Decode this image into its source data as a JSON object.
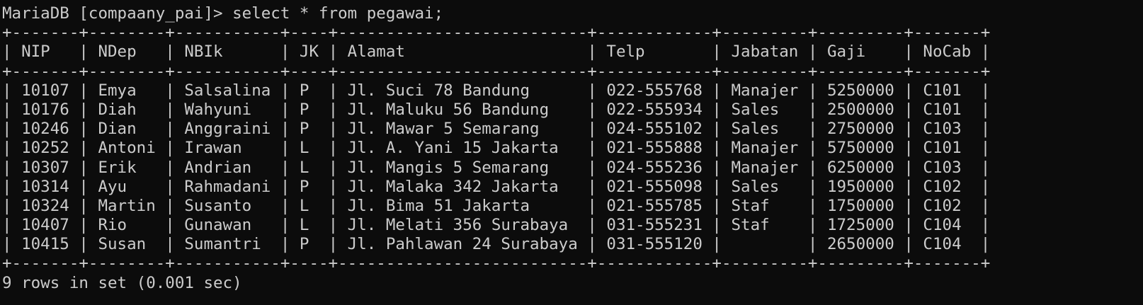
{
  "terminal": {
    "background": "#0c0c0c",
    "foreground": "#cccccc",
    "lines": [
      "MariaDB [compaany_pai]> select * from pegawai;",
      "+-------+--------+-----------+----+--------------------------+------------+---------+---------+-------+",
      "| NIP   | NDep   | NBIk      | JK | Alamat                   | Telp       | Jabatan | Gaji    | NoCab |",
      "+-------+--------+-----------+----+--------------------------+------------+---------+---------+-------+",
      "| 10107 | Emya   | Salsalina | P  | Jl. Suci 78 Bandung      | 022-555768 | Manajer | 5250000 | C101  |",
      "| 10176 | Diah   | Wahyuni   | P  | Jl. Maluku 56 Bandung    | 022-555934 | Sales   | 2500000 | C101  |",
      "| 10246 | Dian   | Anggraini | P  | Jl. Mawar 5 Semarang     | 024-555102 | Sales   | 2750000 | C103  |",
      "| 10252 | Antoni | Irawan    | L  | Jl. A. Yani 15 Jakarta   | 021-555888 | Manajer | 5750000 | C101  |",
      "| 10307 | Erik   | Andrian   | L  | Jl. Mangis 5 Semarang    | 024-555236 | Manajer | 6250000 | C103  |",
      "| 10314 | Ayu    | Rahmadani | P  | Jl. Malaka 342 Jakarta   | 021-555098 | Sales   | 1950000 | C102  |",
      "| 10324 | Martin | Susanto   | L  | Jl. Bima 51 Jakarta      | 021-555785 | Staf    | 1750000 | C102  |",
      "| 10407 | Rio    | Gunawan   | L  | Jl. Melati 356 Surabaya  | 031-555231 | Staf    | 1725000 | C104  |",
      "| 10415 | Susan  | Sumantri  | P  | Jl. Pahlawan 24 Surabaya | 031-555120 |         | 2650000 | C104  |",
      "+-------+--------+-----------+----+--------------------------+------------+---------+---------+-------+",
      "9 rows in set (0.001 sec)"
    ]
  }
}
